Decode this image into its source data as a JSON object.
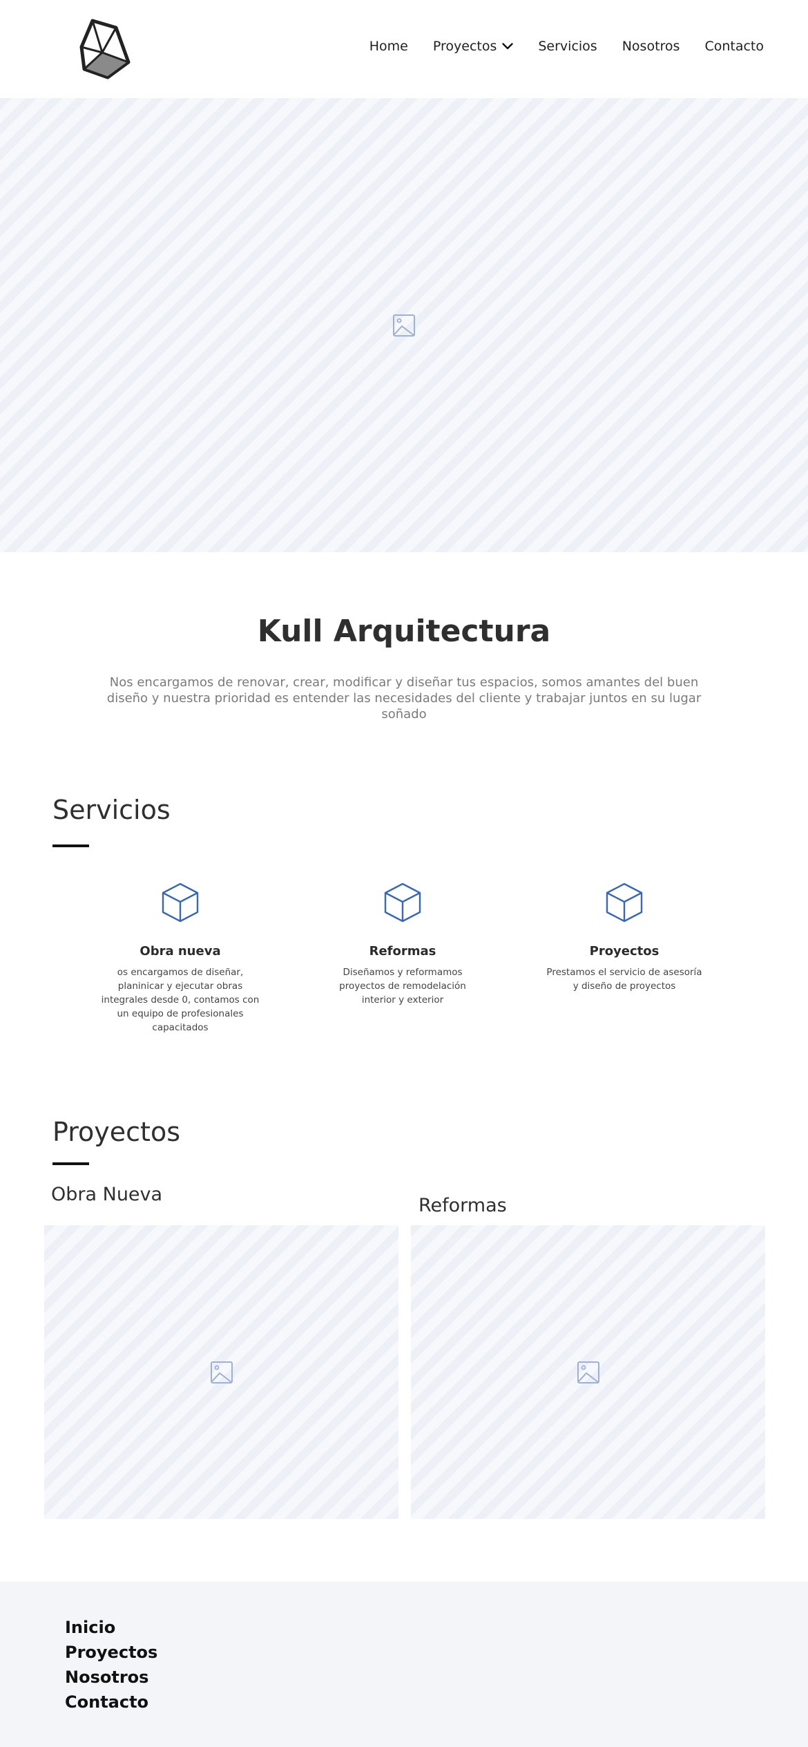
{
  "nav": {
    "items": [
      {
        "label": "Home"
      },
      {
        "label": "Proyectos",
        "has_dropdown": true
      },
      {
        "label": "Servicios"
      },
      {
        "label": "Nosotros"
      },
      {
        "label": "Contacto"
      }
    ]
  },
  "hero": {
    "image_icon": "image-placeholder-icon"
  },
  "intro": {
    "title": "Kull Arquitectura",
    "text": "Nos encargamos de renovar, crear, modificar y diseñar tus espacios, somos amantes del buen diseño y nuestra prioridad es entender las necesidades del cliente y trabajar juntos en su lugar soñado"
  },
  "services": {
    "title": "Servicios",
    "items": [
      {
        "title": "Obra nueva",
        "desc": "os encargamos de diseñar, planinicar y ejecutar obras integrales desde 0, contamos con un equipo de profesionales capacitados",
        "icon": "cube-icon"
      },
      {
        "title": "Reformas",
        "desc": "Diseñamos y reformamos proyectos de remodelación interior y exterior",
        "icon": "cube-icon"
      },
      {
        "title": "Proyectos",
        "desc": "Prestamos el servicio de asesoría y diseño de proyectos",
        "icon": "cube-icon"
      }
    ]
  },
  "projects": {
    "title": "Proyectos",
    "cards": [
      {
        "label": "Obra Nueva"
      },
      {
        "label": "Reformas"
      }
    ]
  },
  "footer": {
    "links": [
      "Inicio",
      "Proyectos",
      "Nosotros",
      "Contacto"
    ]
  },
  "colors": {
    "accent": "#3b66b0",
    "placeholder_bg": "#f7f8fb",
    "footer_bg": "#f4f5f9",
    "text_dark": "#2f2f2f"
  }
}
